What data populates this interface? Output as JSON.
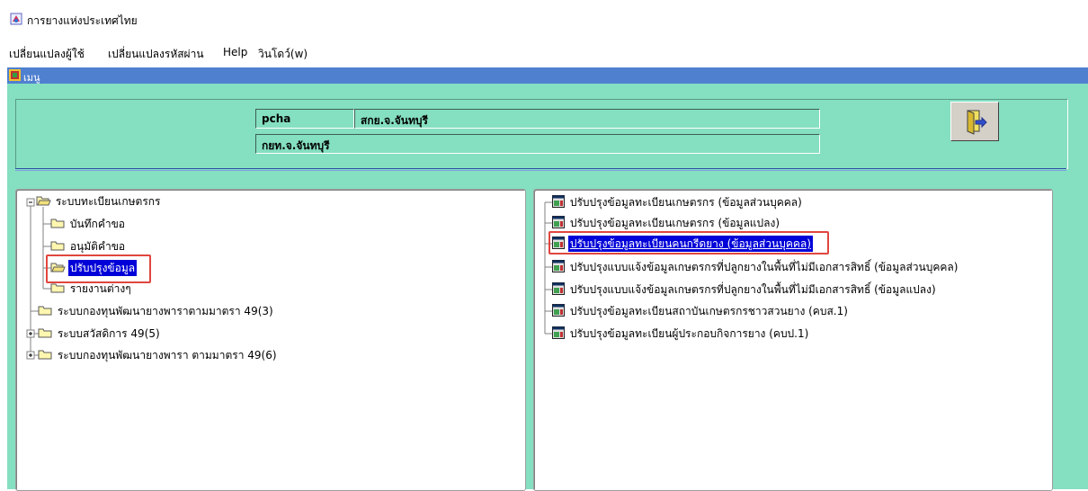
{
  "window": {
    "title": "การยางแห่งประเทศไทย"
  },
  "menu": [
    {
      "label": "เปลี่ยนแปลงผู้ใช้"
    },
    {
      "label": "เปลี่ยนแปลงรหัสผ่าน"
    },
    {
      "label": "Help"
    },
    {
      "label": "วินโดว์(w)"
    }
  ],
  "child_window": {
    "title": "เมนู"
  },
  "header": {
    "user_id": "pcha",
    "office": "สกย.จ.จันทบุรี",
    "department": "กยท.จ.จันทบุรี"
  },
  "left_tree": [
    {
      "label": "ระบบทะเบียนเกษตรกร",
      "state": "expanded"
    },
    {
      "label": "บันทึกคำขอ"
    },
    {
      "label": "อนุมัติคำขอ"
    },
    {
      "label": "ปรับปรุงข้อมูล",
      "selected": true
    },
    {
      "label": "รายงานต่างๆ"
    },
    {
      "label": "ระบบกองทุนพัฒนายางพาราตามมาตรา 49(3)"
    },
    {
      "label": "ระบบสวัสดิการ 49(5)",
      "state": "collapsed"
    },
    {
      "label": "ระบบกองทุนพัฒนายางพารา ตามมาตรา 49(6)",
      "state": "collapsed"
    }
  ],
  "right_list": [
    {
      "label": "ปรับปรุงข้อมูลทะเบียนเกษตรกร (ข้อมูลส่วนบุคคล)"
    },
    {
      "label": "ปรับปรุงข้อมูลทะเบียนเกษตรกร (ข้อมูลแปลง)"
    },
    {
      "label": "ปรับปรุงข้อมูลทะเบียนคนกรีดยาง (ข้อมูลส่วนบุคคล)",
      "selected": true
    },
    {
      "label": "ปรับปรุงแบบแจ้งข้อมูลเกษตรกรที่ปลูกยางในพื้นที่ไม่มีเอกสารสิทธิ์ (ข้อมูลส่วนบุคคล)"
    },
    {
      "label": "ปรับปรุงแบบแจ้งข้อมูลเกษตรกรที่ปลูกยางในพื้นที่ไม่มีเอกสารสิทธิ์ (ข้อมูลแปลง)"
    },
    {
      "label": "ปรับปรุงข้อมูลทะเบียนสถาบันเกษตรกรชาวสวนยาง (คบส.1)"
    },
    {
      "label": "ปรับปรุงข้อมูลทะเบียนผู้ประกอบกิจการยาง (คบป.1)"
    }
  ],
  "colors": {
    "background": "#85dfc1",
    "selection": "#0000d8",
    "highlight_box": "#e0463f",
    "title_bar": "#4f80d0"
  },
  "icons": {
    "app": "app-icon",
    "folder": "folder-icon",
    "form": "form-window-icon",
    "exit": "exit-door-icon"
  }
}
